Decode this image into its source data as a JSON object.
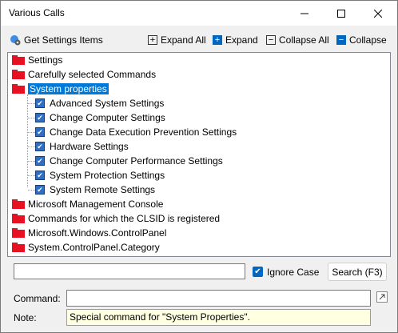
{
  "window": {
    "title": "Various Calls"
  },
  "toolbar": {
    "get_settings": "Get Settings Items",
    "expand_all": "Expand All",
    "expand": "Expand",
    "collapse_all": "Collapse All",
    "collapse": "Collapse"
  },
  "tree": {
    "top": [
      "Settings",
      "Carefully selected Commands",
      "System properties"
    ],
    "children": [
      "Advanced System Settings",
      "Change Computer Settings",
      "Change Data Execution Prevention Settings",
      "Hardware Settings",
      "Change Computer Performance Settings",
      "System Protection Settings",
      "System Remote Settings"
    ],
    "bottom": [
      "Microsoft Management Console",
      "Commands for which the CLSID is registered",
      "Microsoft.Windows.ControlPanel",
      "System.ControlPanel.Category"
    ]
  },
  "search": {
    "value": "",
    "ignore_case_label": "Ignore Case",
    "ignore_case_checked": true,
    "button_label": "Search (F3)"
  },
  "command": {
    "label": "Command:",
    "value": ""
  },
  "note": {
    "label": "Note:",
    "text": "Special command for \"System Properties\"."
  },
  "colors": {
    "folder": "#e81123",
    "selection": "#0078d7",
    "note_bg": "#ffffe1"
  }
}
